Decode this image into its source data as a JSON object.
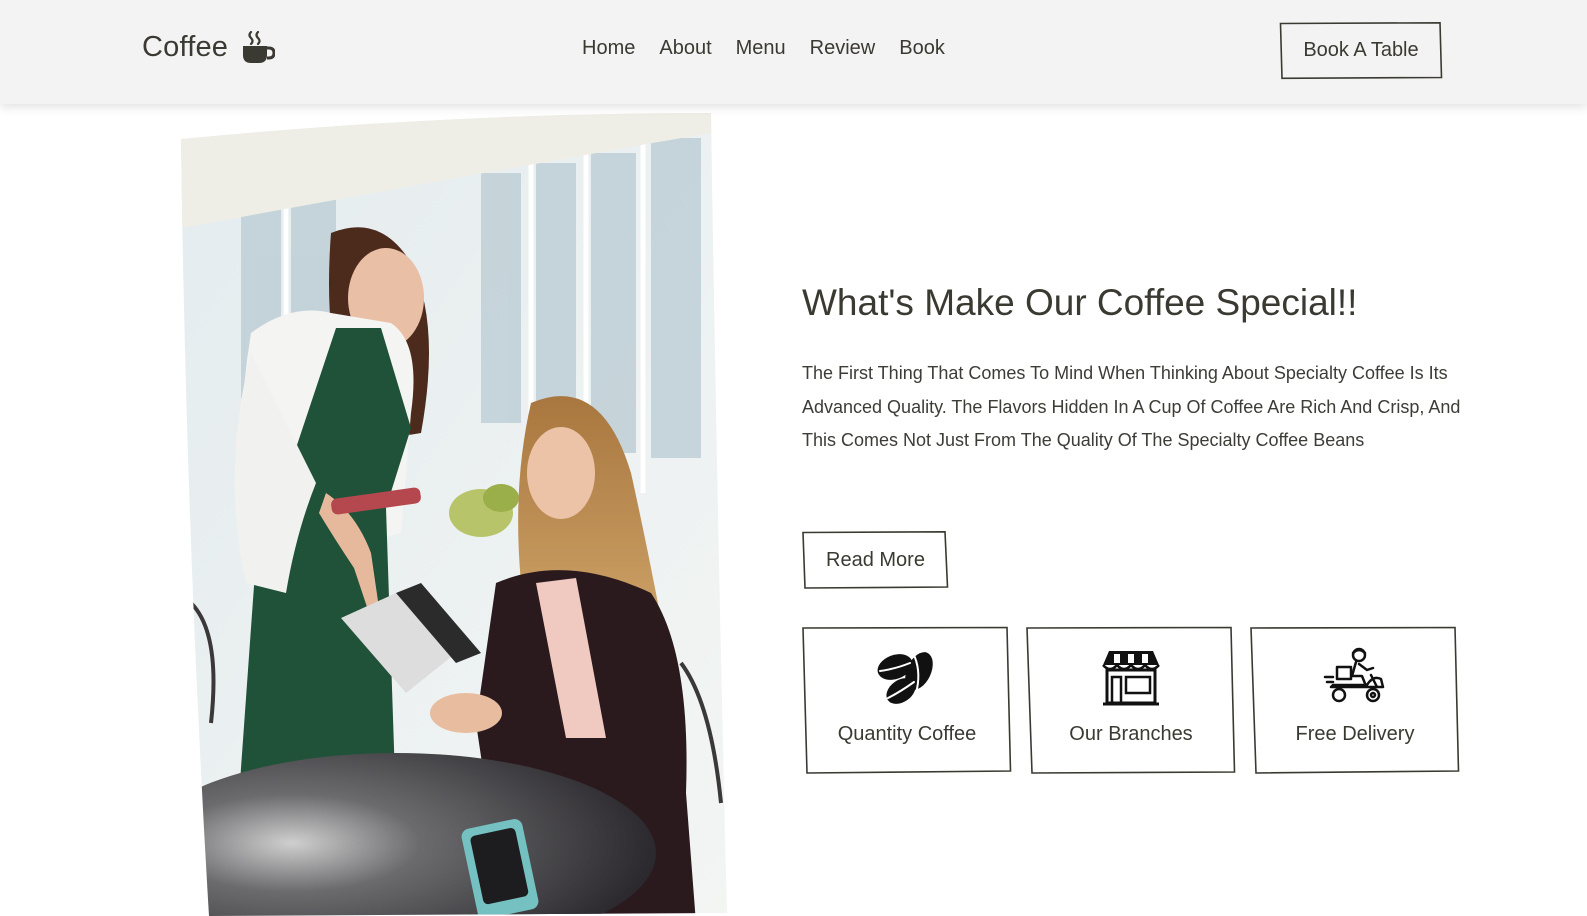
{
  "brand": {
    "name": "Coffee",
    "icon": "coffee-cup-icon"
  },
  "nav": {
    "items": [
      {
        "label": "Home"
      },
      {
        "label": "About"
      },
      {
        "label": "Menu"
      },
      {
        "label": "Review"
      },
      {
        "label": "Book"
      }
    ],
    "cta_label": "Book A Table"
  },
  "hero": {
    "image": "waitress-serving-customer-photo",
    "title": "What's Make Our Coffee Special!!",
    "description": "The First Thing That Comes To Mind When Thinking About Specialty Coffee Is Its Advanced Quality. The Flavors Hidden In A Cup Of Coffee Are Rich And Crisp, And This Comes Not Just From The Quality Of The Specialty Coffee Beans",
    "read_more_label": "Read More"
  },
  "features": [
    {
      "label": "Quantity Coffee",
      "icon": "coffee-beans-icon"
    },
    {
      "label": "Our Branches",
      "icon": "shop-icon"
    },
    {
      "label": "Free Delivery",
      "icon": "delivery-scooter-icon"
    }
  ],
  "colors": {
    "header_bg": "#f4f3f3",
    "text": "#3a3a33",
    "apron_green": "#1f5238",
    "page_bg": "#ffffff"
  }
}
